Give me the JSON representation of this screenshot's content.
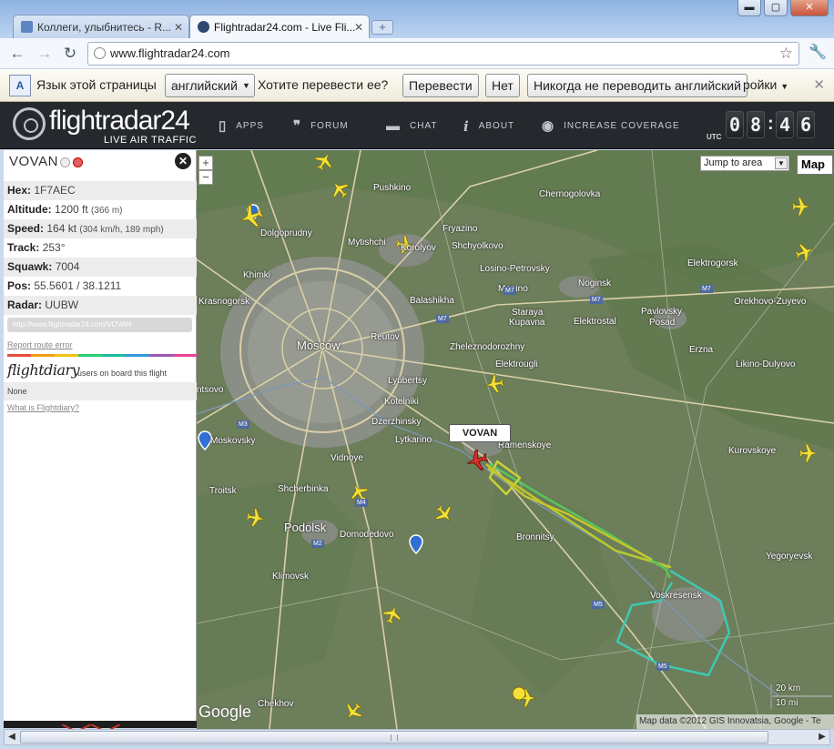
{
  "browser": {
    "tabs": [
      {
        "title": "Коллеги, улыбнитесь - R..."
      },
      {
        "title": "Flightradar24.com - Live Fli..."
      }
    ],
    "new_tab_symbol": "+",
    "url": "www.flightradar24.com"
  },
  "translate_bar": {
    "prompt": "Язык этой страницы",
    "language_value": "английский",
    "question": "Хотите перевести ее?",
    "translate_button": "Перевести",
    "no_button": "Нет",
    "never_button": "Никогда не переводить английский",
    "options_tail": "ройки"
  },
  "site": {
    "logo": "flightradar24",
    "tagline": "LIVE AIR TRAFFIC",
    "nav": [
      {
        "label": "APPS",
        "icon": "phone-icon"
      },
      {
        "label": "FORUM",
        "icon": "quote-icon"
      },
      {
        "label": "CHAT",
        "icon": "chat-bubble-icon"
      },
      {
        "label": "ABOUT",
        "icon": "info-icon"
      },
      {
        "label": "INCREASE COVERAGE",
        "icon": "eye-icon"
      }
    ],
    "utc_label": "UTC",
    "clock": {
      "h1": "0",
      "h2": "8",
      "sep": ":",
      "m1": "4",
      "m2": "6"
    }
  },
  "flight_panel": {
    "callsign": "VOVAN",
    "rows": [
      {
        "label": "Hex:",
        "value": "1F7AEC",
        "extra": ""
      },
      {
        "label": "Altitude:",
        "value": "1200 ft",
        "extra": "(366 m)"
      },
      {
        "label": "Speed:",
        "value": "164 kt",
        "extra": "(304 km/h, 189 mph)"
      },
      {
        "label": "Track:",
        "value": "253°",
        "extra": ""
      },
      {
        "label": "Squawk:",
        "value": "7004",
        "extra": ""
      },
      {
        "label": "Pos:",
        "value": "55.5601 / 38.1211",
        "extra": ""
      },
      {
        "label": "Radar:",
        "value": "UUBW",
        "extra": ""
      }
    ],
    "link_url": "http://www.flightradar24.com/VOVAN",
    "report_link": "Report route error",
    "flightdiary_logo": "flightdiary",
    "flightdiary_text": "users on board this flight",
    "flightdiary_value": "None",
    "flightdiary_link": "What is Flightdiary?"
  },
  "map": {
    "jump_to": "Jump to area",
    "map_type": "Map",
    "selected_flight_label": "VOVAN",
    "cities": [
      {
        "name": "Pushkino"
      },
      {
        "name": "Chernogolovka"
      },
      {
        "name": "Dolgoprudny"
      },
      {
        "name": "Fryazino"
      },
      {
        "name": "Mytishchi"
      },
      {
        "name": "Korolyov"
      },
      {
        "name": "Shchyolkovo"
      },
      {
        "name": "Losino-Petrovsky"
      },
      {
        "name": "Noginsk"
      },
      {
        "name": "Elektrogorsk"
      },
      {
        "name": "Khimki"
      },
      {
        "name": "Monino"
      },
      {
        "name": "Krasnogorsk"
      },
      {
        "name": "Balashikha"
      },
      {
        "name": "Staraya"
      },
      {
        "name": "Kupavna"
      },
      {
        "name": "Elektrostal"
      },
      {
        "name": "Pavlovsky"
      },
      {
        "name": "Posad"
      },
      {
        "name": "Orekhovo-Zuyevo"
      },
      {
        "name": "Moscow"
      },
      {
        "name": "Reutov"
      },
      {
        "name": "Zheleznodorozhny"
      },
      {
        "name": "Elektrougli"
      },
      {
        "name": "Likino-Dulyovo"
      },
      {
        "name": "Lyubertsy"
      },
      {
        "name": "Kotelniki"
      },
      {
        "name": "Dzerzhinsky"
      },
      {
        "name": "Lytkarino"
      },
      {
        "name": "Ramenskoye"
      },
      {
        "name": "Moskovsky"
      },
      {
        "name": "Vidnoye"
      },
      {
        "name": "Kurovskoye"
      },
      {
        "name": "Troitsk"
      },
      {
        "name": "Shcherbinka"
      },
      {
        "name": "Podolsk"
      },
      {
        "name": "Domodedovo"
      },
      {
        "name": "Bronnitsy"
      },
      {
        "name": "Klimovsk"
      },
      {
        "name": "Yegoryevsk"
      },
      {
        "name": "Voskresensk"
      },
      {
        "name": "Chekhov"
      },
      {
        "name": "Erzna"
      },
      {
        "name": "ntsovo"
      }
    ],
    "roads": [
      "M7",
      "M7",
      "M7",
      "M7",
      "M3",
      "M4",
      "M2",
      "M5",
      "M5"
    ],
    "scale_km": "20 km",
    "scale_mi": "10 mi",
    "google": "Google",
    "attribution": "Map data ©2012 GIS Innovatsia, Google - Te"
  }
}
